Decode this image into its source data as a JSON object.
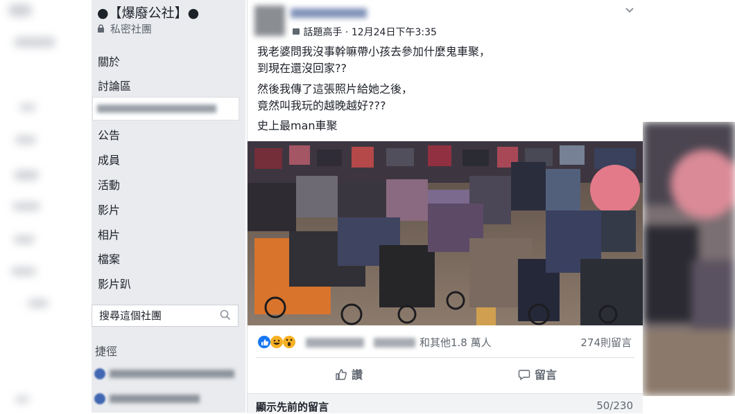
{
  "group": {
    "name": "●【爆廢公社】●",
    "privacy": "私密社團"
  },
  "sidebar": {
    "items": [
      {
        "label": "關於"
      },
      {
        "label": "討論區"
      },
      {
        "label": "公告"
      },
      {
        "label": "成員"
      },
      {
        "label": "活動"
      },
      {
        "label": "影片"
      },
      {
        "label": "相片"
      },
      {
        "label": "檔案"
      },
      {
        "label": "影片趴"
      }
    ],
    "search_placeholder": "搜尋這個社團",
    "shortcuts_label": "捷徑"
  },
  "post": {
    "badge": "話題高手",
    "separator": "·",
    "timestamp": "12月24日下午3:35",
    "lines": [
      "我老婆問我沒事幹嘛帶小孩去參加什麼鬼車聚，",
      "到現在還沒回家??",
      "然後我傳了這張照片給她之後，",
      "竟然叫我玩的越晚越好???",
      "史上最man車聚"
    ],
    "reactions_others": "和其他1.8 萬人",
    "comments_count": "274則留言",
    "like_label": "讚",
    "comment_label": "留言",
    "previous_comments": "顯示先前的留言",
    "comments_progress": "50/230"
  },
  "icons": [
    "lock-icon",
    "search-icon",
    "chevron-down-icon",
    "like-icon",
    "comment-icon",
    "thumbs-up-icon"
  ],
  "colors": {
    "sidebar_bg": "#e9ebee",
    "accent": "#4267b2",
    "muted": "#606770"
  }
}
